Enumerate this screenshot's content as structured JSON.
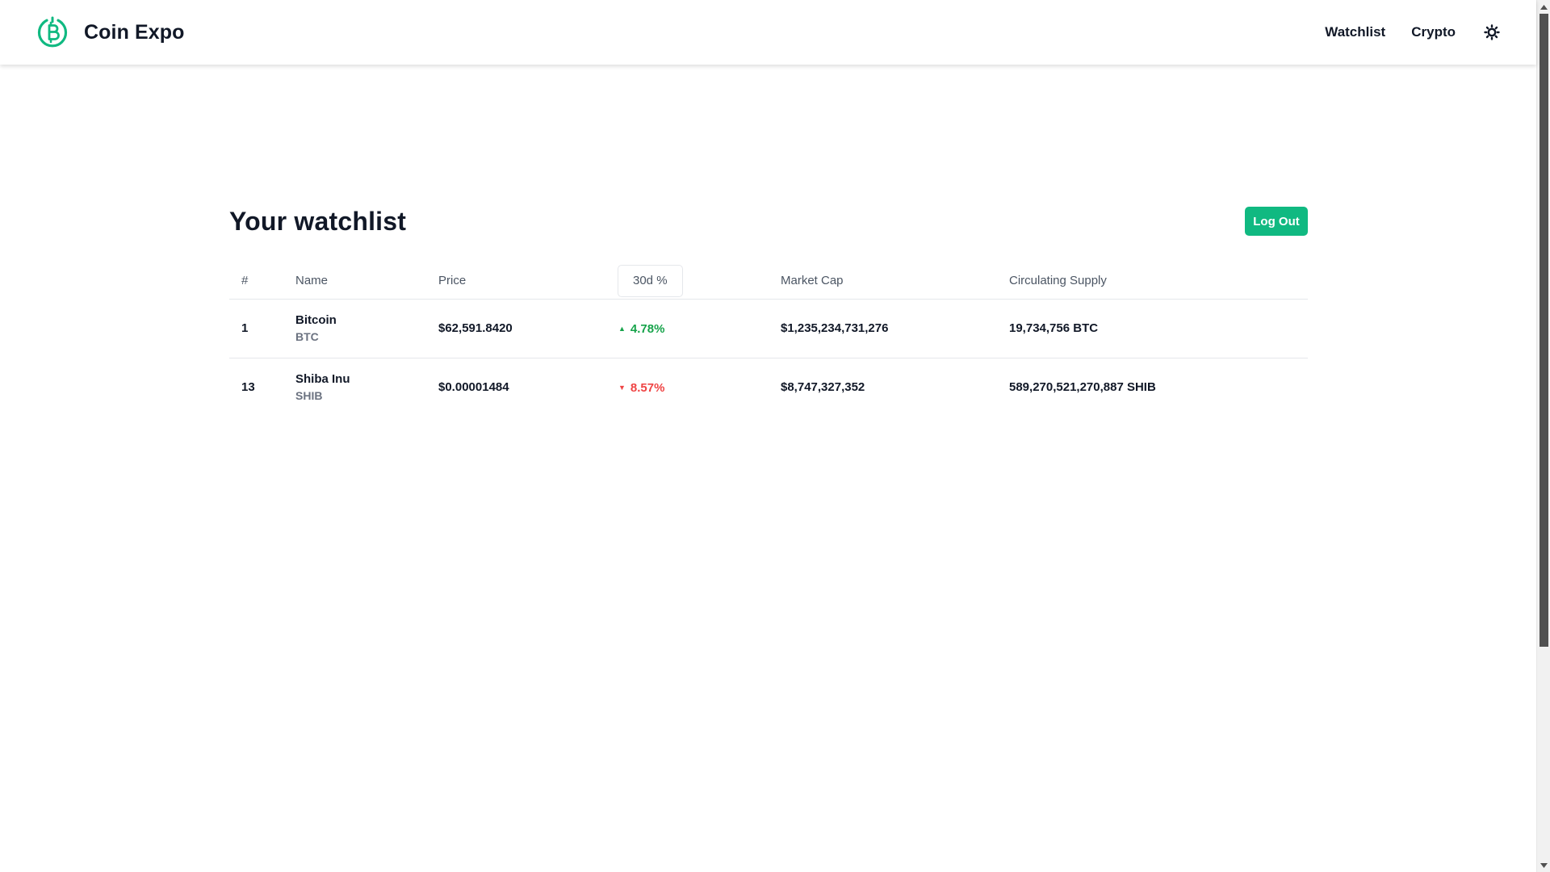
{
  "brand": {
    "name": "Coin Expo",
    "logo_icon": "bitcoin-logo-icon",
    "accent": "#10b981"
  },
  "nav": {
    "watchlist": "Watchlist",
    "crypto": "Crypto",
    "theme_icon": "sun-icon"
  },
  "page": {
    "title": "Your watchlist",
    "logout_label": "Log Out"
  },
  "table": {
    "headers": {
      "rank": "#",
      "name": "Name",
      "price": "Price",
      "change": "30d %",
      "market_cap": "Market Cap",
      "supply": "Circulating Supply"
    },
    "rows": [
      {
        "rank": "1",
        "name": "Bitcoin",
        "symbol": "BTC",
        "price": "$62,591.8420",
        "change": "4.78%",
        "direction": "up",
        "market_cap": "$1,235,234,731,276",
        "supply": "19,734,756 BTC"
      },
      {
        "rank": "13",
        "name": "Shiba Inu",
        "symbol": "SHIB",
        "price": "$0.00001484",
        "change": "8.57%",
        "direction": "down",
        "market_cap": "$8,747,327,352",
        "supply": "589,270,521,270,887 SHIB"
      }
    ]
  },
  "colors": {
    "up": "#16a34a",
    "down": "#ef4444",
    "button": "#10b981"
  }
}
